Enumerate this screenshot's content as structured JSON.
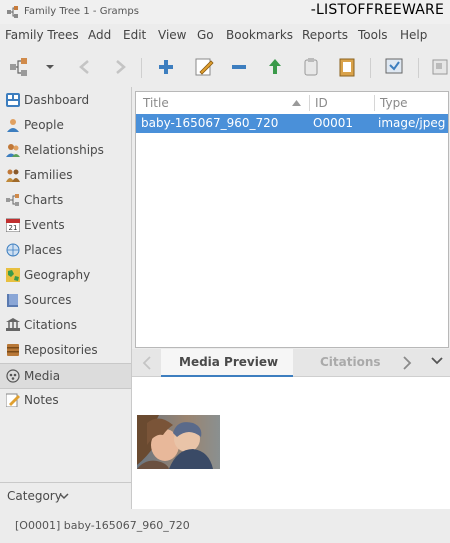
{
  "window": {
    "title": "Family Tree 1 - Gramps",
    "watermark": "-LISTOFFREEWARE"
  },
  "menu": [
    "Family Trees",
    "Add",
    "Edit",
    "View",
    "Go",
    "Bookmarks",
    "Reports",
    "Tools",
    "Help"
  ],
  "toolbar": [
    "tree-icon",
    "dropdown-arrow-icon",
    "back-icon",
    "forward-icon",
    "add-icon",
    "edit-icon",
    "remove-icon",
    "merge-icon",
    "clipboard-icon",
    "reports-icon",
    "tools-icon",
    "extra-icon"
  ],
  "sidebar": {
    "items": [
      {
        "label": "Dashboard",
        "icon": "dashboard-icon"
      },
      {
        "label": "People",
        "icon": "person-icon"
      },
      {
        "label": "Relationships",
        "icon": "relationships-icon"
      },
      {
        "label": "Families",
        "icon": "families-icon"
      },
      {
        "label": "Charts",
        "icon": "charts-icon"
      },
      {
        "label": "Events",
        "icon": "events-icon"
      },
      {
        "label": "Places",
        "icon": "places-icon"
      },
      {
        "label": "Geography",
        "icon": "geography-icon"
      },
      {
        "label": "Sources",
        "icon": "sources-icon"
      },
      {
        "label": "Citations",
        "icon": "citations-icon"
      },
      {
        "label": "Repositories",
        "icon": "repositories-icon"
      },
      {
        "label": "Media",
        "icon": "media-icon"
      },
      {
        "label": "Notes",
        "icon": "notes-icon"
      }
    ],
    "selected": "Media",
    "category_label": "Category"
  },
  "table": {
    "columns": [
      "Title",
      "ID",
      "Type"
    ],
    "rows": [
      {
        "title": "baby-165067_960_720",
        "id": "O0001",
        "type": "image/jpeg"
      }
    ]
  },
  "tabs": {
    "items": [
      "Media Preview",
      "Citations"
    ],
    "active": "Media Preview"
  },
  "status": "[O0001] baby-165067_960_720",
  "colors": {
    "selection": "#4a90d9",
    "accent": "#3d7ebf"
  }
}
